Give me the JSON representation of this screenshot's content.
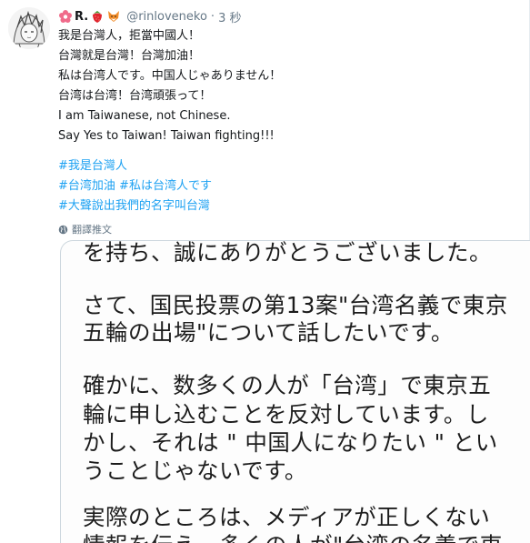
{
  "tweet": {
    "display_name": "R.",
    "handle": "@rinloveneko",
    "separator": "·",
    "time": "3 秒",
    "text_lines": [
      "我是台灣人，拒當中國人！",
      "台灣就是台灣！台灣加油！",
      "私は台湾人です。中国人じゃありません！",
      "台湾は台湾！台湾頑張って！",
      "I am Taiwanese, not Chinese.",
      "Say Yes to Taiwan! Taiwan fighting!!!"
    ],
    "hashtags": {
      "line1": [
        "#我是台灣人"
      ],
      "line2": [
        "#台湾加油",
        "#私は台湾人です"
      ],
      "line3": [
        "#大聲說出我們的名字叫台灣"
      ]
    },
    "translate_label": "翻譯推文",
    "icons": {
      "avatar": "anime-character-avatar",
      "emoji_1": "flower-emoji",
      "emoji_2": "strawberry-emoji",
      "emoji_3": "fox-emoji",
      "translate": "globe-icon"
    }
  },
  "image_text": {
    "line1": "を持ち、誠にありがとうございました。",
    "line2": "さて、国民投票の第13案\"台湾名義で東京",
    "line3": "五輪の出場\"について話したいです。",
    "line4": "確かに、数多くの人が「台湾」で東京五",
    "line5": "輪に申し込むことを反対しています。し",
    "line6": "かし、それは \" 中国人になりたい \" とい",
    "line7": "うことじゃないです。",
    "line8": "実際のところは、メディアが正しくない",
    "line9": "情報を伝え、多くの人が\"台湾の名義で東"
  },
  "colors": {
    "link": "#1da1f2",
    "secondary": "#657786",
    "text": "#14171a"
  }
}
